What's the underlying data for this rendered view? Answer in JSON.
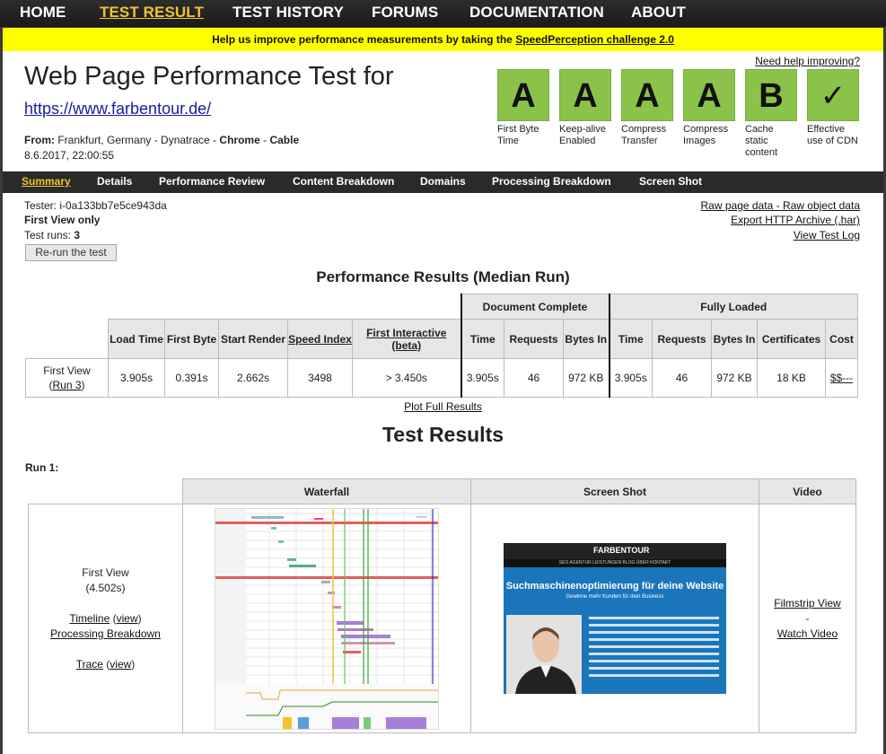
{
  "nav": {
    "items": [
      "HOME",
      "TEST RESULT",
      "TEST HISTORY",
      "FORUMS",
      "DOCUMENTATION",
      "ABOUT"
    ],
    "active": "TEST RESULT"
  },
  "banner": {
    "text": "Help us improve performance measurements by taking the ",
    "link": "SpeedPerception challenge 2.0"
  },
  "help_link": "Need help improving?",
  "header": {
    "title": "Web Page Performance Test for",
    "url": "https://www.farbentour.de/",
    "from_label": "From:",
    "from_location": "Frankfurt, Germany - Dynatrace -",
    "browser": "Chrome",
    "sep": "-",
    "connection": "Cable",
    "date": "8.6.2017, 22:00:55"
  },
  "grades": [
    {
      "grade": "A",
      "label": "First Byte Time"
    },
    {
      "grade": "A",
      "label": "Keep-alive Enabled"
    },
    {
      "grade": "A",
      "label": "Compress Transfer"
    },
    {
      "grade": "A",
      "label": "Compress Images"
    },
    {
      "grade": "B",
      "label": "Cache static content"
    },
    {
      "grade": "✓",
      "label": "Effective use of CDN"
    }
  ],
  "subnav": {
    "items": [
      "Summary",
      "Details",
      "Performance Review",
      "Content Breakdown",
      "Domains",
      "Processing Breakdown",
      "Screen Shot"
    ],
    "active": "Summary"
  },
  "test_info": {
    "tester": "Tester: i-0a133bb7e5ce943da",
    "first_view_only": "First View only",
    "runs_label": "Test runs:",
    "runs": "3",
    "rerun_button": "Re-run the test"
  },
  "right_links": {
    "raw_page": "Raw page data",
    "dash": "-",
    "raw_object": "Raw object data",
    "export": "Export HTTP Archive (.har)",
    "view_log": "View Test Log"
  },
  "perf": {
    "heading": "Performance Results (Median Run)",
    "group_doc": "Document Complete",
    "group_full": "Fully Loaded",
    "columns": {
      "load_time": "Load Time",
      "first_byte": "First Byte",
      "start_render": "Start Render",
      "speed_index": "Speed Index",
      "first_interactive": "First Interactive (beta)",
      "time": "Time",
      "requests": "Requests",
      "bytes_in": "Bytes In",
      "certificates": "Certificates",
      "cost": "Cost"
    },
    "row": {
      "label": "First View",
      "run_open": "(",
      "run_link": "Run 3",
      "run_close": ")",
      "load_time": "3.905s",
      "first_byte": "0.391s",
      "start_render": "2.662s",
      "speed_index": "3498",
      "first_interactive": "> 3.450s",
      "doc_time": "3.905s",
      "doc_requests": "46",
      "doc_bytes": "972 KB",
      "full_time": "3.905s",
      "full_requests": "46",
      "full_bytes": "972 KB",
      "certificates": "18 KB",
      "cost": "$$---"
    },
    "plot_link": "Plot Full Results"
  },
  "results": {
    "heading": "Test Results",
    "run_label": "Run 1:",
    "col_waterfall": "Waterfall",
    "col_screenshot": "Screen Shot",
    "col_video": "Video",
    "first_view": "First View",
    "first_view_time": "(4.502s)",
    "timeline": "Timeline",
    "view": "view",
    "processing": "Processing Breakdown",
    "trace": "Trace",
    "filmstrip": "Filmstrip View",
    "dash": "-",
    "watch_video": "Watch Video"
  },
  "screenshot_content": {
    "logo": "FARBENTOUR",
    "nav": "SEO AGENTUR   LEISTUNGEN   BLOG   ÜBER   KONTAKT",
    "headline": "Suchmaschinenoptimierung für deine Website",
    "subline": "Gewinne mehr Kunden für dein Business"
  },
  "colors": {
    "grade_green": "#8bc34a",
    "active_nav": "#f1c232",
    "banner_yellow": "#ffff00"
  }
}
